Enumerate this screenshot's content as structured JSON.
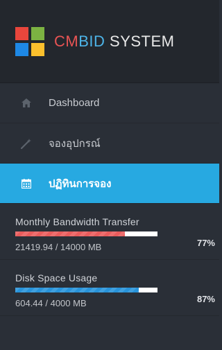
{
  "brand": {
    "prefix": "CMBID",
    "suffix": " SYSTEM",
    "logo_colors": [
      "#e8463c",
      "#7cb342",
      "#1e88e5",
      "#fbc02d"
    ]
  },
  "menu": {
    "items": [
      {
        "label": "Dashboard",
        "icon": "home-icon"
      },
      {
        "label": "จองอุปกรณ์",
        "icon": "magic-wand-icon"
      },
      {
        "label": "ปฏิทินการจอง",
        "icon": "calendar-icon",
        "active": true
      }
    ]
  },
  "stats": {
    "bandwidth": {
      "title": "Monthly Bandwidth Transfer",
      "value": "21419.94 / 14000 MB",
      "percent_label": "77%",
      "fill_fraction": 0.77,
      "color": "#e95b5b"
    },
    "disk": {
      "title": "Disk Space Usage",
      "value": "604.44 / 4000 MB",
      "percent_label": "87%",
      "fill_fraction": 0.87,
      "color": "#2793da"
    }
  },
  "colors": {
    "sidebar_bg": "#2a2f37",
    "header_bg": "#23272d",
    "active_bg": "#27a9e1"
  }
}
